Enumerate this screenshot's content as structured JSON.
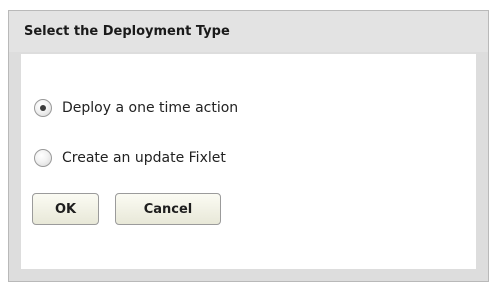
{
  "dialog": {
    "title": "Select the Deployment Type",
    "options": [
      {
        "label": "Deploy a one time action",
        "selected": true
      },
      {
        "label": "Create an update Fixlet",
        "selected": false
      }
    ],
    "ok_label": "OK",
    "cancel_label": "Cancel"
  }
}
